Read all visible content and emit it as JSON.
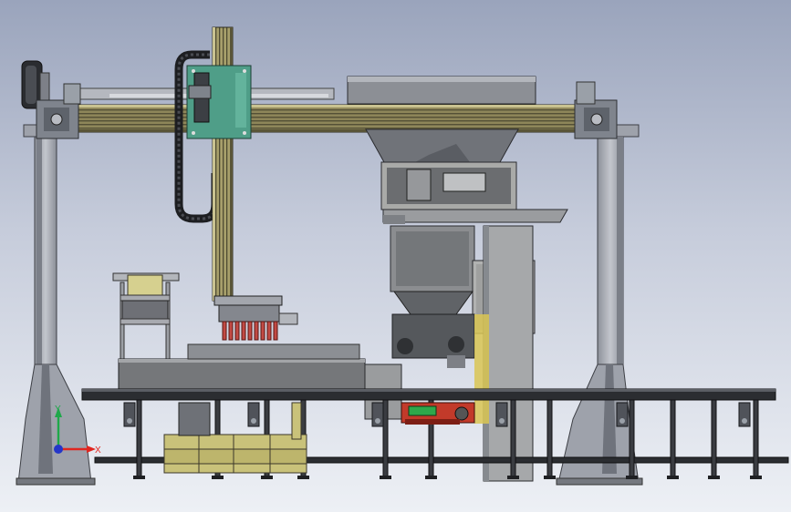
{
  "axis_triad": {
    "x_label": "X",
    "y_label": "Y",
    "x_color": "#e0261f",
    "y_color": "#1fa84a",
    "z_color": "#2436c9"
  },
  "colors": {
    "background_top": "#9aa4bc",
    "background_bottom": "#edf0f5",
    "frame_steel": "#a8acb6",
    "gantry_beam": "#8c8558",
    "carrier_plate": "#4f9e88",
    "cabinet": "#a9aaa8",
    "conveyor": "#2b2d31",
    "bag_tan": "#c9c27a",
    "accent_red": "#c23a2a",
    "accent_green": "#2ea84b"
  },
  "components": [
    "gantry-robot",
    "vertical-lift-column",
    "cable-drag-chain",
    "motor-drum",
    "product-hopper",
    "weighing-hopper",
    "control-cabinet",
    "multi-head-gripper",
    "bag-magazine",
    "roller-conveyor",
    "packed-bags"
  ]
}
